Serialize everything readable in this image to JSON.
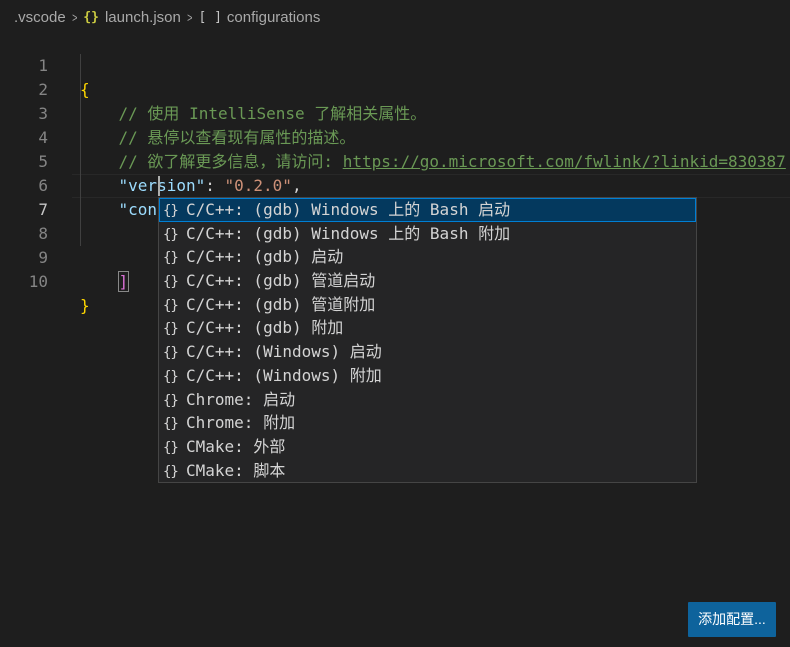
{
  "breadcrumb": {
    "folder": ".vscode",
    "file_icon": "{}",
    "file": "launch.json",
    "symbol_icon": "[ ]",
    "symbol": "configurations"
  },
  "editor": {
    "lines": [
      {
        "num": "1",
        "text": "{"
      },
      {
        "num": "2",
        "text": "    // 使用 IntelliSense 了解相关属性。"
      },
      {
        "num": "3",
        "text": "    // 悬停以查看现有属性的描述。"
      },
      {
        "num": "4",
        "comment_prefix": "    // 欲了解更多信息，请访问: ",
        "link": "https://go.microsoft.com/fwlink/?linkid=830387"
      },
      {
        "num": "5",
        "key": "\"version\"",
        "colon": ": ",
        "value": "\"0.2.0\"",
        "trail": ","
      },
      {
        "num": "6",
        "key": "\"configurations\"",
        "colon": ": ",
        "bracket": "["
      },
      {
        "num": "7",
        "text": ""
      },
      {
        "num": "8",
        "text": ""
      },
      {
        "num": "9",
        "bracket": "]"
      },
      {
        "num": "10",
        "text": "}"
      }
    ]
  },
  "suggestions": [
    {
      "icon": "{}",
      "label": "C/C++: (gdb) Windows 上的 Bash 启动",
      "selected": true
    },
    {
      "icon": "{}",
      "label": "C/C++: (gdb) Windows 上的 Bash 附加"
    },
    {
      "icon": "{}",
      "label": "C/C++: (gdb) 启动"
    },
    {
      "icon": "{}",
      "label": "C/C++: (gdb) 管道启动"
    },
    {
      "icon": "{}",
      "label": "C/C++: (gdb) 管道附加"
    },
    {
      "icon": "{}",
      "label": "C/C++: (gdb) 附加"
    },
    {
      "icon": "{}",
      "label": "C/C++: (Windows) 启动"
    },
    {
      "icon": "{}",
      "label": "C/C++: (Windows) 附加"
    },
    {
      "icon": "{}",
      "label": "Chrome: 启动"
    },
    {
      "icon": "{}",
      "label": "Chrome: 附加"
    },
    {
      "icon": "{}",
      "label": "CMake: 外部"
    },
    {
      "icon": "{}",
      "label": "CMake: 脚本"
    }
  ],
  "add_config_button": "添加配置...",
  "colors": {
    "background": "#1e1e1e",
    "comment": "#6a9955",
    "key": "#9cdcfe",
    "string": "#ce9178",
    "brace": "#ffd700",
    "bracket": "#da70d6",
    "selection": "#04395e",
    "button": "#0e639c"
  }
}
